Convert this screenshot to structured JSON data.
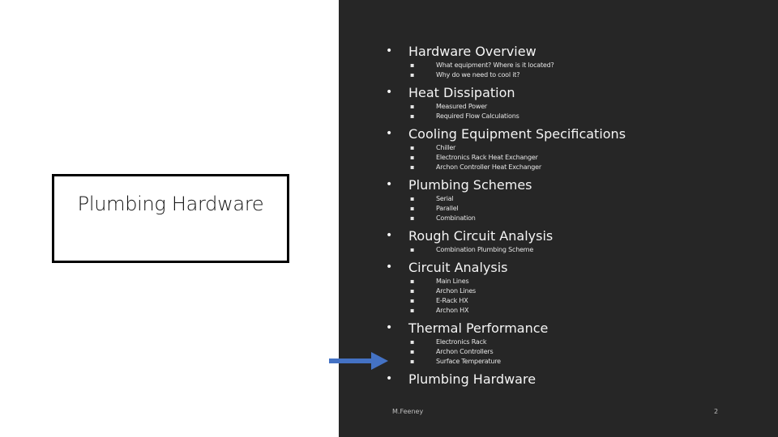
{
  "slide": {
    "title": "Plumbing Hardware",
    "accent_color": "#4472C4",
    "agenda": [
      {
        "label": "Hardware Overview",
        "subs": [
          "What equipment? Where is it located?",
          "Why do we need to cool it?"
        ]
      },
      {
        "label": "Heat Dissipation",
        "subs": [
          "Measured Power",
          "Required Flow Calculations"
        ]
      },
      {
        "label": "Cooling Equipment Specifications",
        "subs": [
          "Chiller",
          "Electronics Rack Heat Exchanger",
          "Archon Controller Heat Exchanger"
        ]
      },
      {
        "label": "Plumbing Schemes",
        "subs": [
          "Serial",
          "Parallel",
          "Combination"
        ]
      },
      {
        "label": "Rough Circuit Analysis",
        "subs": [
          "Combination Plumbing Scheme"
        ]
      },
      {
        "label": "Circuit Analysis",
        "subs": [
          "Main Lines",
          "Archon Lines",
          "E-Rack HX",
          "Archon HX"
        ]
      },
      {
        "label": "Thermal Performance",
        "subs": [
          "Electronics Rack",
          "Archon Controllers",
          "Surface Temperature"
        ]
      },
      {
        "label": "Plumbing Hardware",
        "subs": []
      }
    ],
    "current_item": "Plumbing Hardware",
    "footer": {
      "author": "M.Feeney",
      "page_number": "2"
    }
  }
}
